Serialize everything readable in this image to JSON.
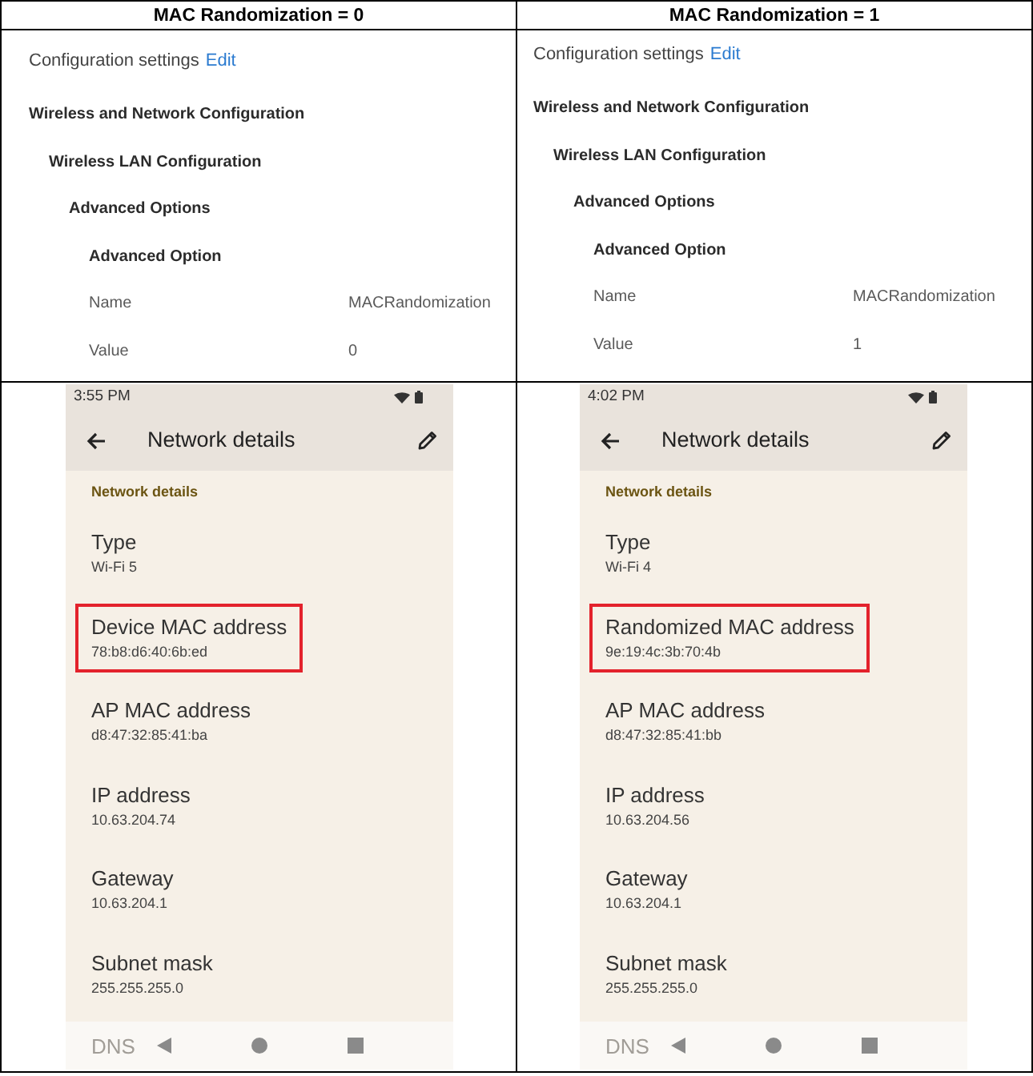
{
  "table": {
    "columns": [
      {
        "heading": "MAC Randomization = 0",
        "config": {
          "title": "Configuration settings",
          "edit_link": "Edit",
          "tree": [
            {
              "label": "Wireless and Network Configuration",
              "children": [
                {
                  "label": "Wireless LAN Configuration",
                  "children": [
                    {
                      "label": "Advanced Options",
                      "children": [
                        {
                          "label": "Advanced Option",
                          "fields": [
                            {
                              "name": "Name",
                              "value": "MACRandomization"
                            },
                            {
                              "name": "Value",
                              "value": "0"
                            }
                          ]
                        }
                      ]
                    }
                  ]
                }
              ]
            }
          ]
        },
        "phone": {
          "status_bar": {
            "time": "3:55 PM"
          },
          "app_bar": {
            "title": "Network details"
          },
          "section_header": "Network details",
          "items": [
            {
              "title": "Type",
              "value": "Wi-Fi 5",
              "highlighted": false
            },
            {
              "title": "Device MAC address",
              "value": "78:b8:d6:40:6b:ed",
              "highlighted": true
            },
            {
              "title": "AP MAC address",
              "value": "d8:47:32:85:41:ba",
              "highlighted": false
            },
            {
              "title": "IP address",
              "value": "10.63.204.74",
              "highlighted": false
            },
            {
              "title": "Gateway",
              "value": "10.63.204.1",
              "highlighted": false
            },
            {
              "title": "Subnet mask",
              "value": "255.255.255.0",
              "highlighted": false
            }
          ],
          "covered_item": {
            "title": "DNS"
          }
        }
      },
      {
        "heading": "MAC Randomization = 1",
        "config": {
          "title": "Configuration settings",
          "edit_link": "Edit",
          "tree": [
            {
              "label": "Wireless and Network Configuration",
              "children": [
                {
                  "label": "Wireless LAN Configuration",
                  "children": [
                    {
                      "label": "Advanced Options",
                      "children": [
                        {
                          "label": "Advanced Option",
                          "fields": [
                            {
                              "name": "Name",
                              "value": "MACRandomization"
                            },
                            {
                              "name": "Value",
                              "value": "1"
                            }
                          ]
                        }
                      ]
                    }
                  ]
                }
              ]
            }
          ]
        },
        "phone": {
          "status_bar": {
            "time": "4:02 PM"
          },
          "app_bar": {
            "title": "Network details"
          },
          "section_header": "Network details",
          "items": [
            {
              "title": "Type",
              "value": "Wi-Fi 4",
              "highlighted": false
            },
            {
              "title": "Randomized MAC address",
              "value": "9e:19:4c:3b:70:4b",
              "highlighted": true
            },
            {
              "title": "AP MAC address",
              "value": "d8:47:32:85:41:bb",
              "highlighted": false
            },
            {
              "title": "IP address",
              "value": "10.63.204.56",
              "highlighted": false
            },
            {
              "title": "Gateway",
              "value": "10.63.204.1",
              "highlighted": false
            },
            {
              "title": "Subnet mask",
              "value": "255.255.255.0",
              "highlighted": false
            }
          ],
          "covered_item": {
            "title": "DNS"
          }
        }
      }
    ]
  }
}
